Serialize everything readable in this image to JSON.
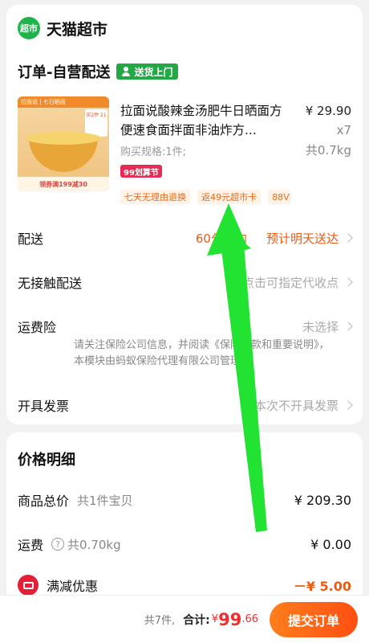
{
  "store": {
    "logo_text": "超市",
    "name": "天猫超市"
  },
  "order": {
    "title": "订单-自营配送",
    "delivery_badge": "送货上门"
  },
  "product": {
    "title": "拉面说酸辣金汤肥牛日晒面方便速食面拌面非油炸方...",
    "unit_price": "¥ 29.90",
    "quantity": "x7",
    "weight": "共0.7kg",
    "spec": "购买规格:1件;",
    "festival_badge": "99划算节",
    "image_top_text": "拉面说 | 七日晒面",
    "image_tag_text": "买2件 21",
    "image_bottom_text": "领券满199减30",
    "tags": [
      "七天无理由退换",
      "返49元超市卡",
      "88VIP"
    ]
  },
  "rows": {
    "delivery": {
      "label": "配送",
      "time": "60分钟内",
      "estimate": "预计明天送达"
    },
    "contactless": {
      "label": "无接触配送",
      "value": "点击可指定代收点"
    },
    "insurance": {
      "label": "运费险",
      "value": "未选择",
      "note": "请关注保险公司信息，并阅读《保险条款和重要说明》，本模块由蚂蚁保险代理有限公司管理。"
    },
    "invoice": {
      "label": "开具发票",
      "value": "本次不开具发票"
    }
  },
  "price_detail": {
    "title": "价格明细",
    "goods_total": {
      "label": "商品总价",
      "sub": "共1件宝贝",
      "value": "¥ 209.30"
    },
    "shipping": {
      "label": "运费",
      "help": "?",
      "sub": "共0.70kg",
      "value": "¥ 0.00"
    },
    "discount": {
      "label": "满减优惠",
      "value": "－¥ 5.00"
    }
  },
  "bottom": {
    "count": "共7件,",
    "total_label": "合计:",
    "currency": "¥",
    "total_int": "99",
    "total_dec": ".66",
    "submit_label": "提交订单"
  },
  "colors": {
    "accent": "#ef5a11",
    "brand_green": "#22a845",
    "price_red": "#ef2f2f",
    "arrow": "#22e232"
  }
}
